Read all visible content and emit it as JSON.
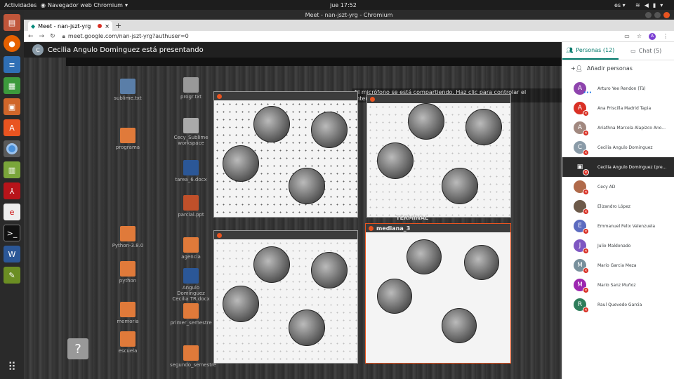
{
  "os": {
    "activities": "Actividades",
    "app_name": "Navegador web Chromium",
    "clock": "jue 17:52",
    "lang": "es"
  },
  "browser": {
    "window_title": "Meet - nan-jszt-yrg - Chromium",
    "tab_title": "Meet - nan-jszt-yrg",
    "url": "meet.google.com/nan-jszt-yrg?authuser=0",
    "profile_initial": "A"
  },
  "meet": {
    "presenter_initial": "C",
    "presenter_text": "Cecilia Angulo Dominguez está presentando",
    "mic_notice": "El micrófono se está compartiendo. Haz clic para controlar el intercambio",
    "panel_title": "mediana_3",
    "terminal_label": "TERMINAL",
    "desktop_icons": [
      "sublime.txt",
      "programa",
      "tarea_6.docx",
      "progr.txt",
      "Cecy_Sublime workspace",
      "python",
      "agencia",
      "Angulo Dominguez Cecilia TR.docx",
      "primer_semestre",
      "segundo_semestre",
      "memoria",
      "escuela",
      "Python-3.8.0",
      "parcial.ppt"
    ]
  },
  "sidebar": {
    "people_tab": "Personas (12)",
    "chat_tab": "Chat (5)",
    "add_people": "Añadir personas",
    "participants": [
      {
        "initial": "A",
        "name": "Arturo Yee Rendon (Tú)",
        "color": "#8e44ad",
        "muted": false,
        "you": true
      },
      {
        "initial": "A",
        "name": "Ana Priscilla Madrid Tapia",
        "color": "#d93025",
        "muted": true
      },
      {
        "initial": "A",
        "name": "Ariathna Marcela Alapizco Ano...",
        "color": "#a1887f",
        "muted": true
      },
      {
        "initial": "C",
        "name": "Cecilia Angulo Dominguez",
        "color": "#8a9ba8",
        "muted": true
      },
      {
        "initial": "",
        "name": "Cecilia Angulo Dominguez (pre...",
        "color": "#2b2b2b",
        "muted": true,
        "presentation": true
      },
      {
        "initial": "",
        "name": "Cecy AD",
        "color": "#b06a4a",
        "muted": true
      },
      {
        "initial": "",
        "name": "Elizandro López",
        "color": "#6d5a4a",
        "muted": true
      },
      {
        "initial": "E",
        "name": "Emmanuel Felix Valenzuela",
        "color": "#5c6bc0",
        "muted": true
      },
      {
        "initial": "J",
        "name": "Julio Maldonado",
        "color": "#7e57c2",
        "muted": true
      },
      {
        "initial": "M",
        "name": "Mario Garcia Meza",
        "color": "#78909c",
        "muted": true
      },
      {
        "initial": "M",
        "name": "Mario Sanz Muñoz",
        "color": "#9c27b0",
        "muted": true
      },
      {
        "initial": "R",
        "name": "Raul Quevedo Garcia",
        "color": "#2e7d5b",
        "muted": true
      }
    ]
  }
}
